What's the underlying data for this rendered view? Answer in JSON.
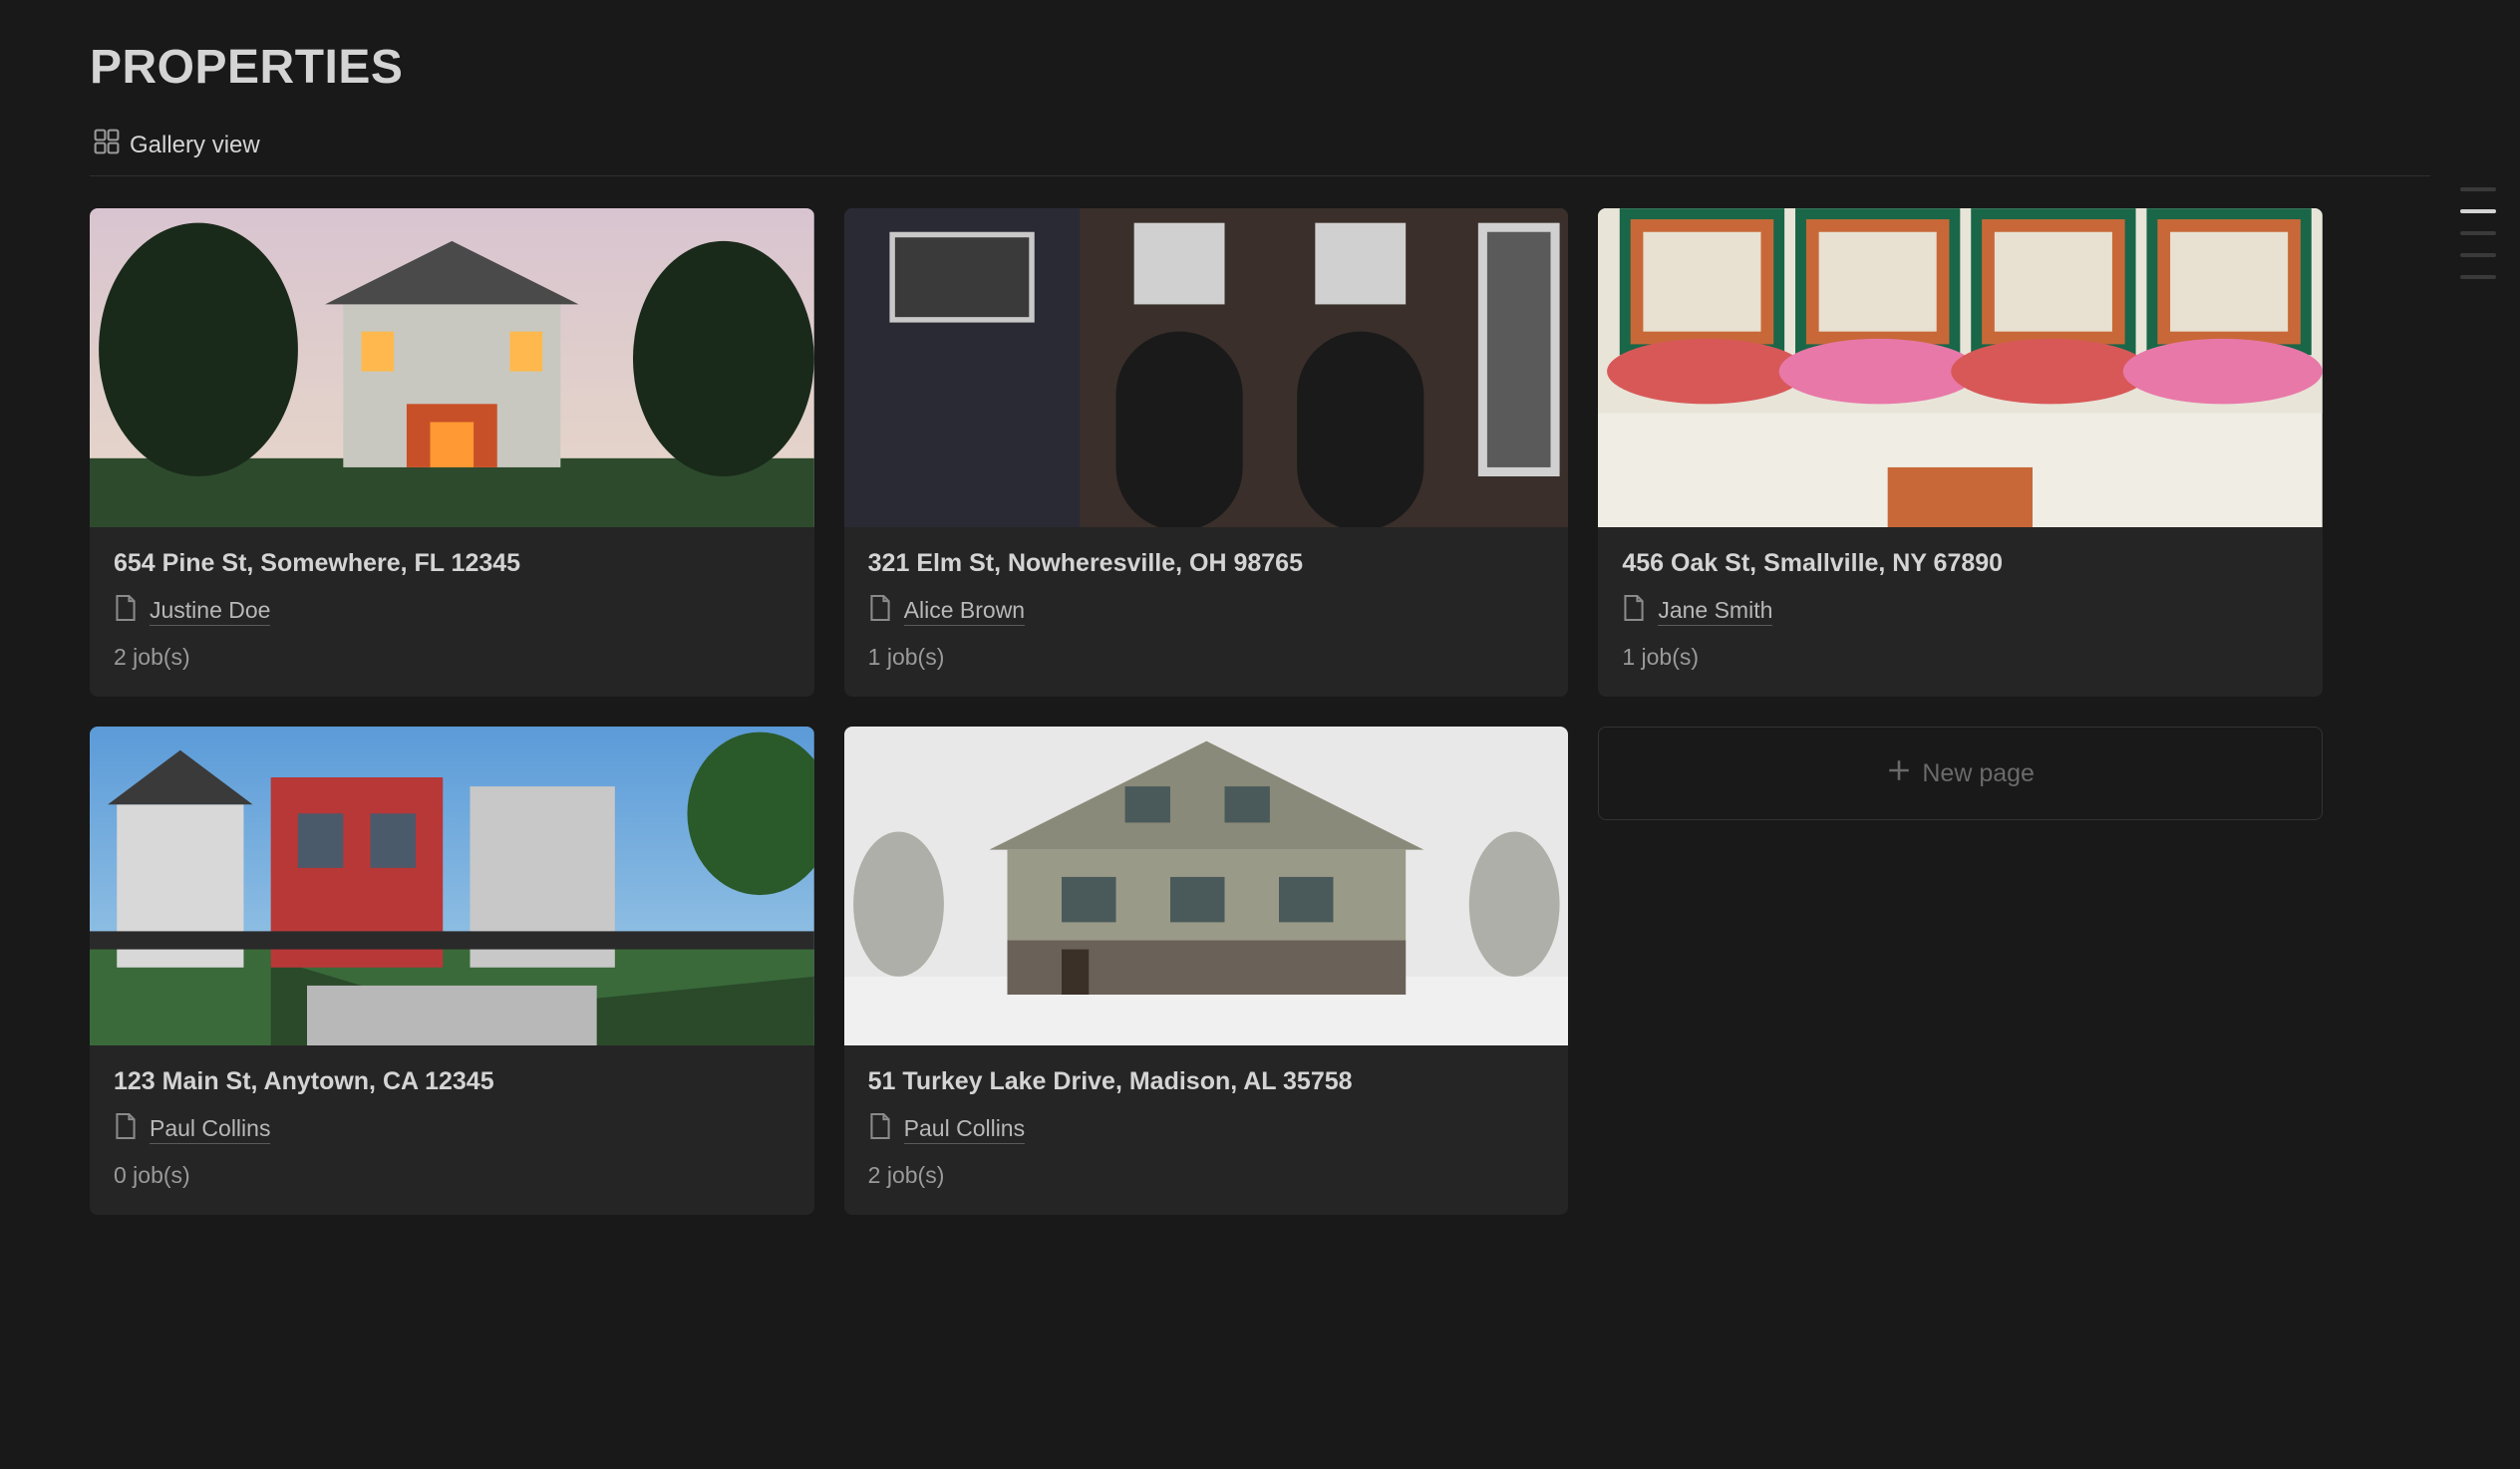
{
  "page": {
    "title": "PROPERTIES",
    "view_label": "Gallery view",
    "new_page_label": "New page"
  },
  "properties": [
    {
      "address": "654 Pine St, Somewhere, FL 12345",
      "person": "Justine Doe",
      "jobs": "2 job(s)"
    },
    {
      "address": "321 Elm St, Nowheresville, OH 98765",
      "person": "Alice Brown",
      "jobs": "1 job(s)"
    },
    {
      "address": "456 Oak St, Smallville, NY 67890",
      "person": "Jane Smith",
      "jobs": "1 job(s)"
    },
    {
      "address": "123 Main St, Anytown, CA 12345",
      "person": "Paul Collins",
      "jobs": "0 job(s)"
    },
    {
      "address": "51 Turkey Lake Drive, Madison, AL 35758",
      "person": "Paul Collins",
      "jobs": "2 job(s)"
    }
  ]
}
